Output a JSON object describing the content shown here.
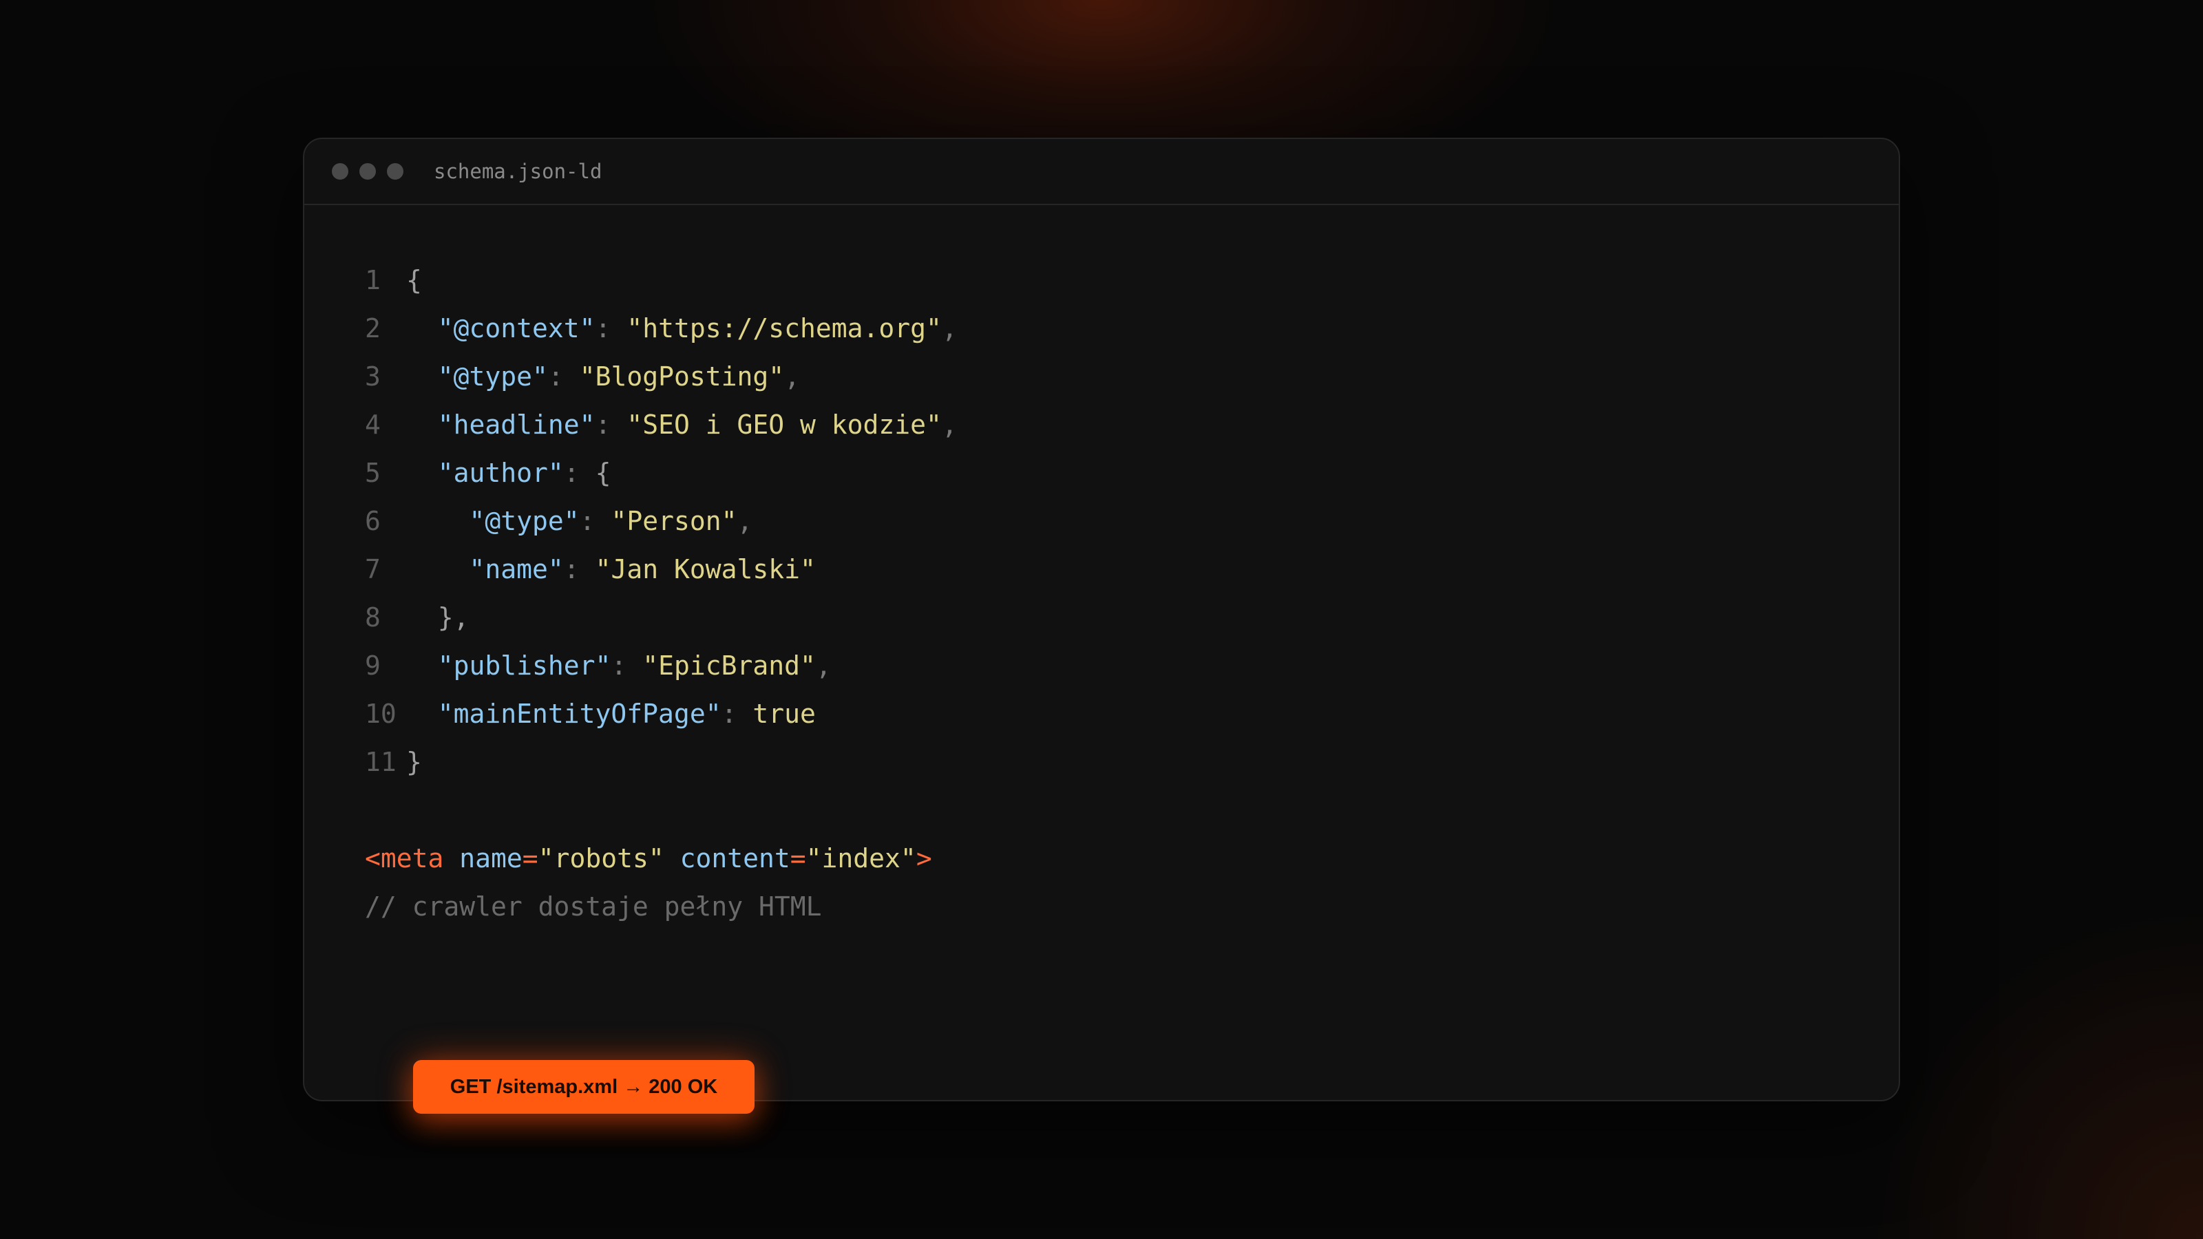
{
  "window": {
    "filename": "schema.json-ld",
    "dots": [
      "window-dot",
      "window-dot",
      "window-dot"
    ]
  },
  "code": {
    "line_numbers": [
      "1",
      "2",
      "3",
      "4",
      "5",
      "6",
      "7",
      "8",
      "9",
      "10",
      "11"
    ],
    "l1": {
      "open": "{"
    },
    "l2": {
      "key": "\"@context\"",
      "colon": ":",
      "value": "\"https://schema.org\"",
      "comma": ","
    },
    "l3": {
      "key": "\"@type\"",
      "colon": ":",
      "value": "\"BlogPosting\"",
      "comma": ","
    },
    "l4": {
      "key": "\"headline\"",
      "colon": ":",
      "value": "\"SEO i GEO w kodzie\"",
      "comma": ","
    },
    "l5": {
      "key": "\"author\"",
      "colon": ":",
      "open": "{"
    },
    "l6": {
      "key": "\"@type\"",
      "colon": ":",
      "value": "\"Person\"",
      "comma": ","
    },
    "l7": {
      "key": "\"name\"",
      "colon": ":",
      "value": "\"Jan Kowalski\""
    },
    "l8": {
      "close": "},"
    },
    "l9": {
      "key": "\"publisher\"",
      "colon": ":",
      "value": "\"EpicBrand\"",
      "comma": ","
    },
    "l10": {
      "key": "\"mainEntityOfPage\"",
      "colon": ":",
      "value": "true"
    },
    "l11": {
      "close": "}"
    },
    "meta_line": {
      "tag_open": "<meta",
      "attr1": "name",
      "eq": "=",
      "val1": "\"robots\"",
      "attr2": "content",
      "val2": "\"index\"",
      "tag_close": ">"
    },
    "comment": "// crawler dostaje pełny HTML"
  },
  "status_pill": {
    "label": "GET /sitemap.xml → 200 OK"
  },
  "colors": {
    "accent": "#ff5a10",
    "key": "#8ec7f0",
    "string": "#dfd58a",
    "tag": "#ff6b3d",
    "comment": "#6a6a6a"
  }
}
